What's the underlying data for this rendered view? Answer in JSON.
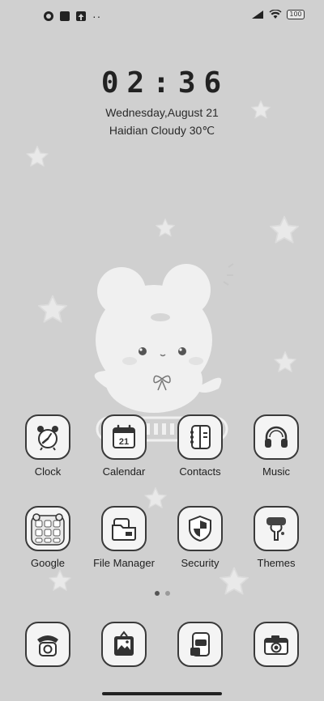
{
  "status_bar": {
    "battery_level": "100",
    "left_icons": [
      "app-notification-icon",
      "square-notification-icon",
      "upload-notification-icon",
      "more-dots-icon"
    ],
    "right_icons": [
      "signal-icon",
      "wifi-icon",
      "battery-icon"
    ]
  },
  "lockclock": {
    "time": "02:36",
    "date": "Wednesday,August 21",
    "weather": "Haidian Cloudy 30℃"
  },
  "apps_row1": [
    {
      "label": "Clock",
      "icon": "alarm-clock-icon"
    },
    {
      "label": "Calendar",
      "icon": "calendar-icon",
      "day": "21"
    },
    {
      "label": "Contacts",
      "icon": "contacts-book-icon"
    },
    {
      "label": "Music",
      "icon": "headphones-icon"
    }
  ],
  "apps_row2": [
    {
      "label": "Google",
      "icon": "google-folder-icon"
    },
    {
      "label": "File Manager",
      "icon": "folder-icon"
    },
    {
      "label": "Security",
      "icon": "shield-icon"
    },
    {
      "label": "Themes",
      "icon": "paint-roller-icon"
    }
  ],
  "dock": [
    {
      "icon": "phone-icon"
    },
    {
      "icon": "gallery-icon"
    },
    {
      "icon": "messages-icon"
    },
    {
      "icon": "camera-icon"
    }
  ],
  "pager": {
    "pages": 2,
    "current": 1
  },
  "colors": {
    "background": "#d0d0d0",
    "icon_bg": "#f4f4f4",
    "outline": "#3a3a3a"
  }
}
